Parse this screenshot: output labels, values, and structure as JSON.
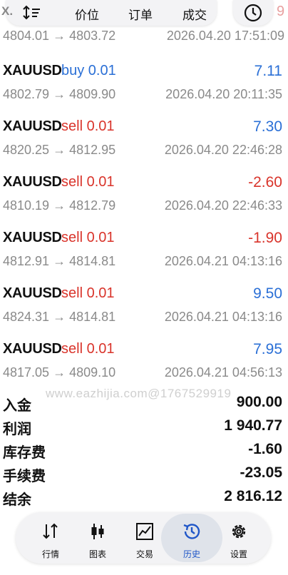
{
  "top": {
    "left_fragment": "X.",
    "tabs": [
      "价位",
      "订单",
      "成交"
    ],
    "right_fragment": "9"
  },
  "partial_row": {
    "prices": "4804.01 → 4803.72",
    "time": "2026.04.20 17:51:09"
  },
  "deals": [
    {
      "symbol": "XAUUSD",
      "side": "buy 0.01",
      "type": "buy",
      "profit": "7.11",
      "prices": "4802.79 → 4809.90",
      "time": "2026.04.20 20:11:35"
    },
    {
      "symbol": "XAUUSD",
      "side": "sell 0.01",
      "type": "sell",
      "profit": "7.30",
      "prices": "4820.25 → 4812.95",
      "time": "2026.04.20 22:46:28"
    },
    {
      "symbol": "XAUUSD",
      "side": "sell 0.01",
      "type": "sell",
      "profit": "-2.60",
      "prices": "4810.19 → 4812.79",
      "time": "2026.04.20 22:46:33"
    },
    {
      "symbol": "XAUUSD",
      "side": "sell 0.01",
      "type": "sell",
      "profit": "-1.90",
      "prices": "4812.91 → 4814.81",
      "time": "2026.04.21 04:13:16"
    },
    {
      "symbol": "XAUUSD",
      "side": "sell 0.01",
      "type": "sell",
      "profit": "9.50",
      "prices": "4824.31 → 4814.81",
      "time": "2026.04.21 04:13:16"
    },
    {
      "symbol": "XAUUSD",
      "side": "sell 0.01",
      "type": "sell",
      "profit": "7.95",
      "prices": "4817.05 → 4809.10",
      "time": "2026.04.21 04:56:13"
    }
  ],
  "watermark": "www.eazhijia.com@1767529919",
  "summary": [
    {
      "label": "入金",
      "value": "900.00"
    },
    {
      "label": "利润",
      "value": "1 940.77"
    },
    {
      "label": "库存费",
      "value": "-1.60"
    },
    {
      "label": "手续费",
      "value": "-23.05"
    },
    {
      "label": "结余",
      "value": "2 816.12"
    }
  ],
  "nav": [
    {
      "label": "行情",
      "icon": "quotes-arrows-icon"
    },
    {
      "label": "图表",
      "icon": "candlestick-chart-icon"
    },
    {
      "label": "交易",
      "icon": "trade-line-chart-icon"
    },
    {
      "label": "历史",
      "icon": "history-clock-icon",
      "active": true
    },
    {
      "label": "设置",
      "icon": "settings-gear-icon"
    }
  ],
  "colors": {
    "buy": "#2a6fd6",
    "sell": "#d9342b",
    "muted": "#8a8a8a",
    "active": "#1f56c8"
  }
}
